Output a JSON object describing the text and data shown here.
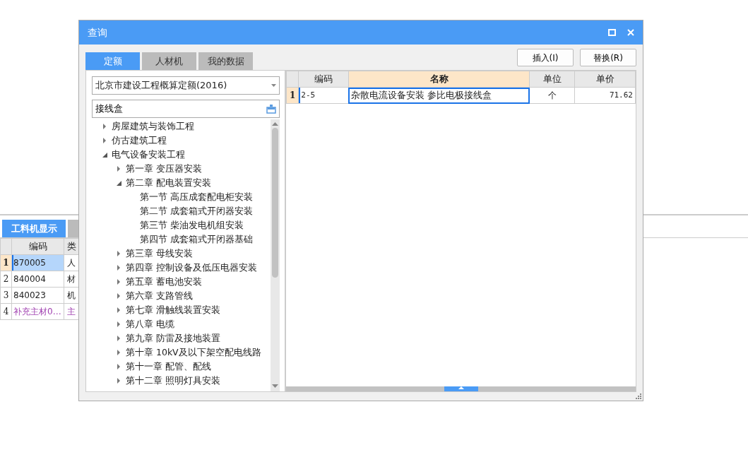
{
  "background": {
    "tabs": [
      {
        "label": "工料机显示",
        "selected": true
      },
      {
        "selected": false
      }
    ],
    "table": {
      "columns": [
        "编码",
        "类"
      ],
      "rows": [
        {
          "num": "1",
          "code": "870005",
          "type": "人",
          "selected": true,
          "kind": "normal"
        },
        {
          "num": "2",
          "code": "840004",
          "type": "材",
          "selected": false,
          "kind": "normal"
        },
        {
          "num": "3",
          "code": "840023",
          "type": "机",
          "selected": false,
          "kind": "normal"
        },
        {
          "num": "4",
          "code": "补充主材0…",
          "type": "主",
          "selected": false,
          "kind": "supplement"
        }
      ]
    }
  },
  "dialog": {
    "title": "查询",
    "tabs": [
      {
        "label": "定额",
        "selected": true
      },
      {
        "label": "人材机",
        "selected": false
      },
      {
        "label": "我的数据",
        "selected": false
      }
    ],
    "buttons": [
      "插入(I)",
      "替换(R)"
    ],
    "library_select": {
      "value": "北京市建设工程概算定额(2016)"
    },
    "search": {
      "value": "接线盒"
    },
    "tree": [
      {
        "label": "房屋建筑与装饰工程",
        "expanded": false
      },
      {
        "label": "仿古建筑工程",
        "expanded": false
      },
      {
        "label": "电气设备安装工程",
        "expanded": true,
        "children": [
          {
            "label": "第一章 变压器安装",
            "expanded": false
          },
          {
            "label": "第二章 配电装置安装",
            "expanded": true,
            "children": [
              {
                "label": "第一节 高压成套配电柜安装"
              },
              {
                "label": "第二节 成套箱式开闭器安装"
              },
              {
                "label": "第三节 柴油发电机组安装"
              },
              {
                "label": "第四节 成套箱式开闭器基础"
              }
            ]
          },
          {
            "label": "第三章 母线安装",
            "expanded": false
          },
          {
            "label": "第四章 控制设备及低压电器安装",
            "expanded": false
          },
          {
            "label": "第五章 蓄电池安装",
            "expanded": false
          },
          {
            "label": "第六章 支路管线",
            "expanded": false
          },
          {
            "label": "第七章 滑触线装置安装",
            "expanded": false
          },
          {
            "label": "第八章 电缆",
            "expanded": false
          },
          {
            "label": "第九章 防雷及接地装置",
            "expanded": false
          },
          {
            "label": "第十章 10kV及以下架空配电线路",
            "expanded": false
          },
          {
            "label": "第十一章 配管、配线",
            "expanded": false
          },
          {
            "label": "第十二章 照明灯具安装",
            "expanded": false
          }
        ]
      }
    ],
    "grid": {
      "columns": [
        {
          "label": "编码",
          "highlighted": false
        },
        {
          "label": "名称",
          "highlighted": true
        },
        {
          "label": "单位",
          "highlighted": false
        },
        {
          "label": "单价",
          "highlighted": false
        }
      ],
      "rows": [
        {
          "num": "1",
          "cells": [
            "2-5",
            "杂散电流设备安装 参比电极接线盒",
            "个",
            "71.62"
          ],
          "selected": true
        }
      ]
    }
  }
}
